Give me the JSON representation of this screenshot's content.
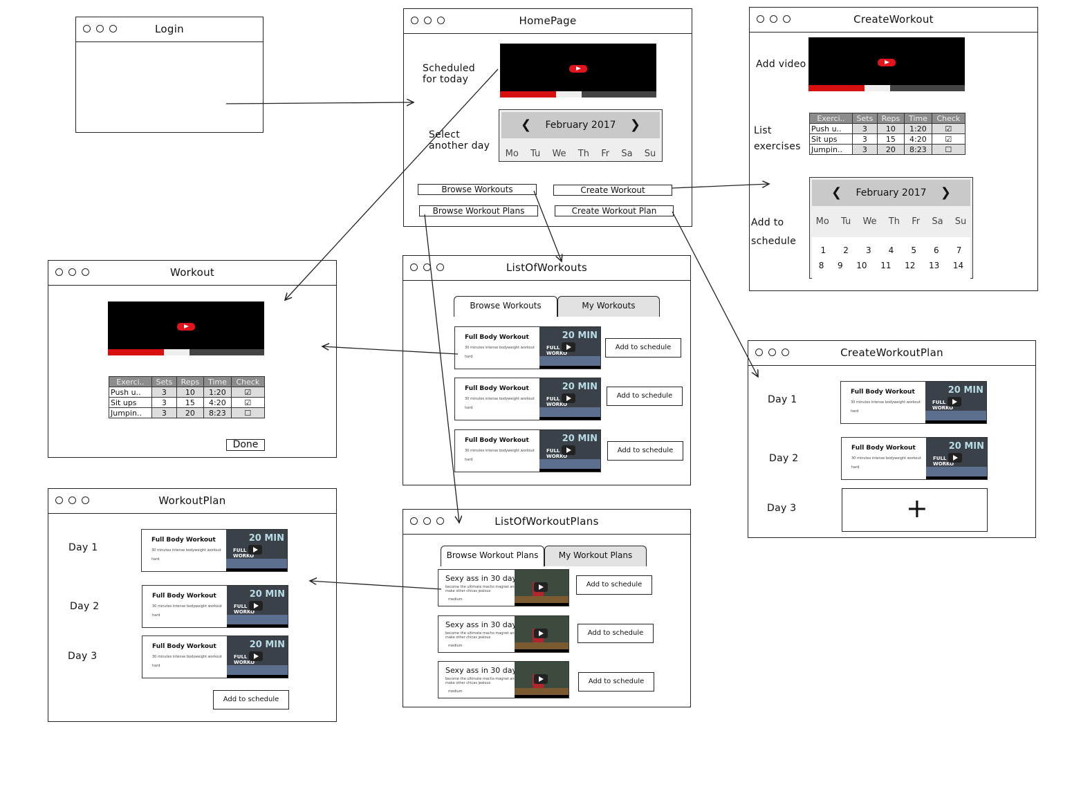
{
  "windows": {
    "login": {
      "title": "Login"
    },
    "homepage": {
      "title": "HomePage",
      "scheduled": "Scheduled\nfor today",
      "select_day": "Select\nanother day",
      "btn_browse_workouts": "Browse Workouts",
      "btn_create_workout": "Create Workout",
      "btn_browse_plans": "Browse Workout Plans",
      "btn_create_plan": "Create Workout Plan"
    },
    "create_workout": {
      "title": "CreateWorkout",
      "add_video": "Add video",
      "list_exercises": "List\nexercises",
      "add_schedule": "Add to\nschedule"
    },
    "workout": {
      "title": "Workout",
      "done": "Done"
    },
    "list_workouts": {
      "title": "ListOfWorkouts",
      "tab1": "Browse Workouts",
      "tab2": "My Workouts"
    },
    "create_plan": {
      "title": "CreateWorkoutPlan",
      "day1": "Day 1",
      "day2": "Day 2",
      "day3": "Day 3",
      "plus": "+"
    },
    "workout_plan": {
      "title": "WorkoutPlan",
      "day1": "Day 1",
      "day2": "Day 2",
      "day3": "Day 3",
      "add": "Add to schedule"
    },
    "list_plans": {
      "title": "ListOfWorkoutPlans",
      "tab1": "Browse Workout Plans",
      "tab2": "My Workout Plans"
    }
  },
  "calendar": {
    "month": "February 2017",
    "prev": "❮",
    "next": "❯",
    "weekdays": [
      "Mo",
      "Tu",
      "We",
      "Th",
      "Fr",
      "Sa",
      "Su"
    ],
    "week1": [
      "1",
      "2",
      "3",
      "4",
      "5",
      "6",
      "7"
    ],
    "week2": [
      "8",
      "9",
      "10",
      "11",
      "12",
      "13",
      "14"
    ]
  },
  "exercise_table": {
    "headers": [
      "Exerci..",
      "Sets",
      "Reps",
      "Time",
      "Check"
    ],
    "rows": [
      [
        "Push u..",
        "3",
        "10",
        "1:20",
        "☑"
      ],
      [
        "Sit ups",
        "3",
        "15",
        "4:20",
        "☑"
      ],
      [
        "Jumpin..",
        "3",
        "20",
        "8:23",
        "☐"
      ]
    ]
  },
  "workout_card": {
    "title": "Full Body Workout",
    "desc": "30 minutes intense bodyweight workout",
    "level": "hard",
    "thumb_big": "20 MIN",
    "thumb_small": "FULL BO\nWORKO"
  },
  "plan_card": {
    "title": "Sexy ass in 30 days",
    "desc": "become the ultimate macho magnet and make other chicas jealous",
    "level": "medium"
  },
  "add_to_schedule": "Add to schedule"
}
